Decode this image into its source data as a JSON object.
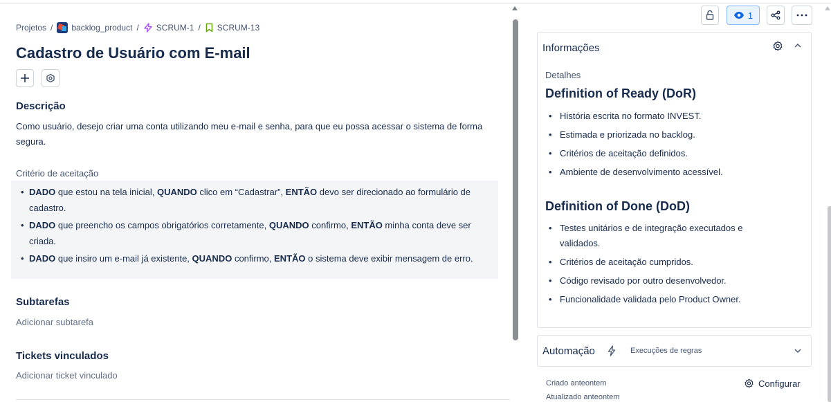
{
  "breadcrumb": {
    "root": "Projetos",
    "separator": "/",
    "project": "backlog_product",
    "epic": "SCRUM-1",
    "story": "SCRUM-13"
  },
  "issue": {
    "title": "Cadastro de Usuário com E-mail"
  },
  "description": {
    "heading": "Descrição",
    "text": "Como usuário, desejo criar uma conta utilizando meu e-mail e senha, para que eu possa acessar o sistema de forma segura."
  },
  "criteria": {
    "label": "Critério de aceitação",
    "items": [
      {
        "dado": "DADO",
        "t1": " que estou na tela inicial, ",
        "quando": "QUANDO",
        "t2": " clico em “Cadastrar”, ",
        "entao": "ENTÃO",
        "t3": " devo ser direcionado ao formulário de cadastro."
      },
      {
        "dado": "DADO",
        "t1": " que preencho os campos obrigatórios corretamente, ",
        "quando": "QUANDO",
        "t2": " confirmo, ",
        "entao": "ENTÃO",
        "t3": " minha conta deve ser criada."
      },
      {
        "dado": "DADO",
        "t1": " que insiro um e-mail já existente, ",
        "quando": "QUANDO",
        "t2": " confirmo, ",
        "entao": "ENTÃO",
        "t3": " o sistema deve exibir mensagem de erro."
      }
    ]
  },
  "subtasks": {
    "heading": "Subtarefas",
    "add_label": "Adicionar subtarefa"
  },
  "linked": {
    "heading": "Tickets vinculados",
    "add_label": "Adicionar ticket vinculado"
  },
  "toolbar": {
    "watch_count": "1"
  },
  "info_panel": {
    "title": "Informações",
    "details_label": "Detalhes",
    "dor_heading": "Definition of Ready (DoR)",
    "dor_items": [
      "História escrita no formato INVEST.",
      "Estimada e priorizada no backlog.",
      "Critérios de aceitação definidos.",
      "Ambiente de desenvolvimento acessível."
    ],
    "dod_heading": "Definition of Done (DoD)",
    "dod_items": [
      "Testes unitários e de integração executados e validados.",
      "Critérios de aceitação cumpridos.",
      "Código revisado por outro desenvolvedor.",
      "Funcionalidade validada pelo Product Owner."
    ]
  },
  "automation": {
    "title": "Automação",
    "subtitle": "Execuções de regras"
  },
  "meta": {
    "created": "Criado anteontem",
    "updated": "Atualizado anteontem",
    "configure_label": "Configurar"
  },
  "colors": {
    "text": "#172b4d",
    "muted": "#626f86",
    "watch_bg": "#e9f2ff",
    "watch_fg": "#0c66e4",
    "epic_purple": "#a855f7",
    "story_green": "#65a30d"
  },
  "icons": {
    "project": "project-avatar-icon",
    "epic": "epic-lightning-icon",
    "story": "story-bookmark-icon",
    "add": "plus-icon",
    "apps": "apps-icon",
    "lock": "lock-icon",
    "eye": "eye-icon",
    "share": "share-icon",
    "more": "more-icon",
    "gear": "gear-icon",
    "chevron_up": "chevron-up-icon",
    "chevron_down": "chevron-down-icon",
    "bolt": "bolt-icon"
  }
}
